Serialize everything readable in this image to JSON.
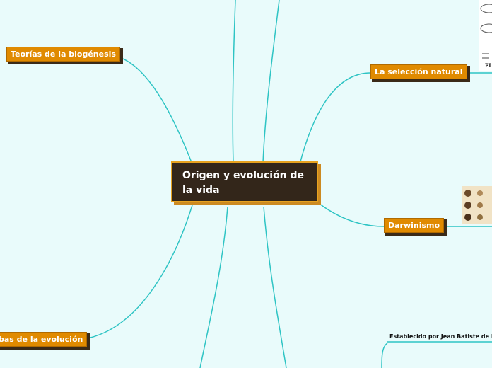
{
  "central": {
    "title": "Origen y evolución de la vida"
  },
  "topics": [
    {
      "label": "Teorías de la biogénesis"
    },
    {
      "label": "La selección natural"
    },
    {
      "label": "Darwinismo"
    },
    {
      "label": "bas de la evolución"
    }
  ],
  "annotation": {
    "text": "Establecido por Jean Batiste de Mone"
  },
  "images": [
    {
      "name": "book-cover-image",
      "text": "PI"
    },
    {
      "name": "evolution-heads-image"
    }
  ],
  "colors": {
    "link": "#2ec4c4",
    "topic_fill": "#e08a00",
    "central_fill": "#33261a",
    "central_border": "#e7a21f",
    "background": "#e9fbfb"
  }
}
